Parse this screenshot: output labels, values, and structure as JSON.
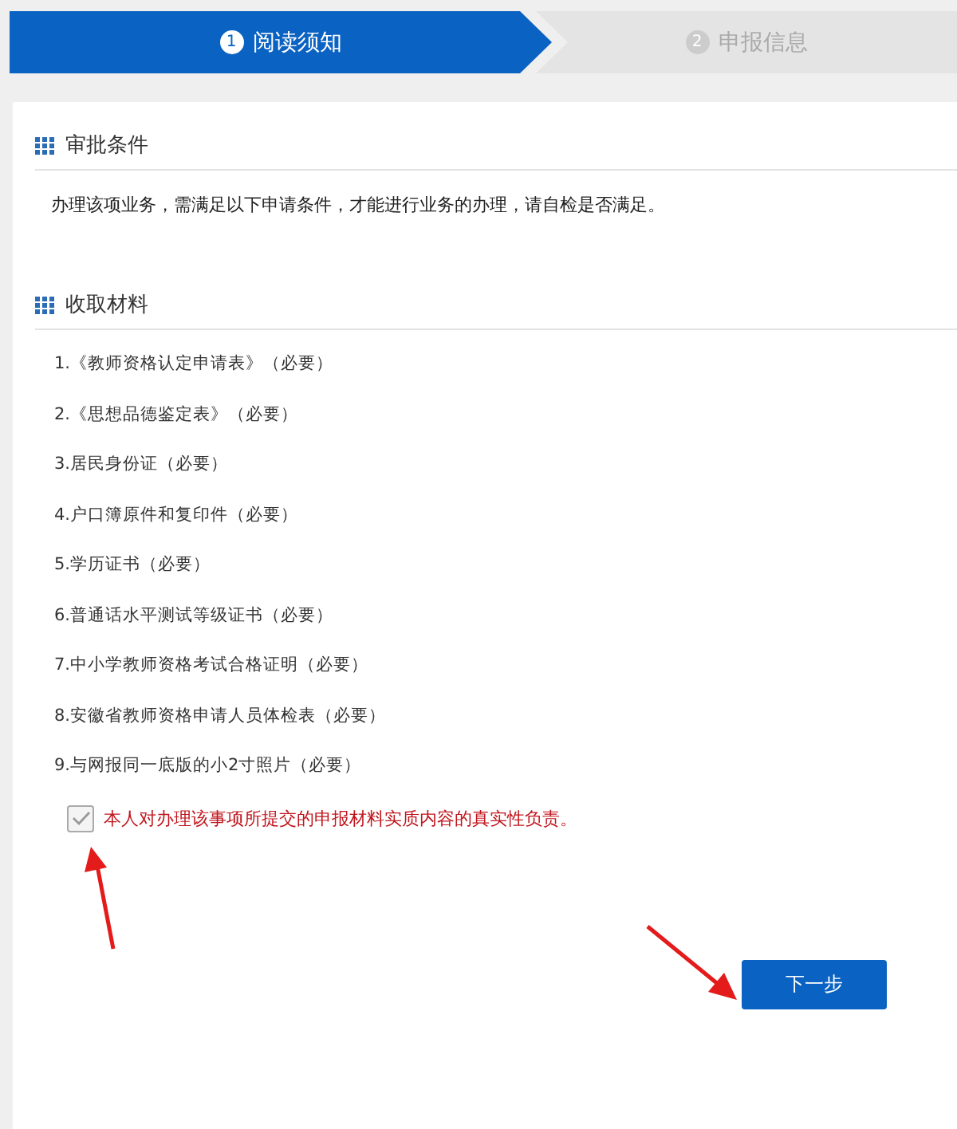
{
  "steps": [
    {
      "number": "1",
      "label": "阅读须知",
      "selected": true
    },
    {
      "number": "2",
      "label": "申报信息",
      "selected": false
    }
  ],
  "sections": [
    {
      "title": "审批条件",
      "kind": "text",
      "text": "办理该项业务，需满足以下申请条件，才能进行业务的办理，请自检是否满足。"
    },
    {
      "title": "收取材料",
      "kind": "list",
      "items": [
        "1.《教师资格认定申请表》（必要）",
        "2.《思想品德鉴定表》（必要）",
        "3.居民身份证（必要）",
        "4.户口簿原件和复印件（必要）",
        "5.学历证书（必要）",
        "6.普通话水平测试等级证书（必要）",
        "7.中小学教师资格考试合格证明（必要）",
        "8.安徽省教师资格申请人员体检表（必要）",
        "9.与网报同一底版的小2寸照片（必要）"
      ]
    }
  ],
  "agreement": {
    "label": "本人对办理该事项所提交的申报材料实质内容的真实性负责。",
    "checked": true
  },
  "next_button": "下一步"
}
